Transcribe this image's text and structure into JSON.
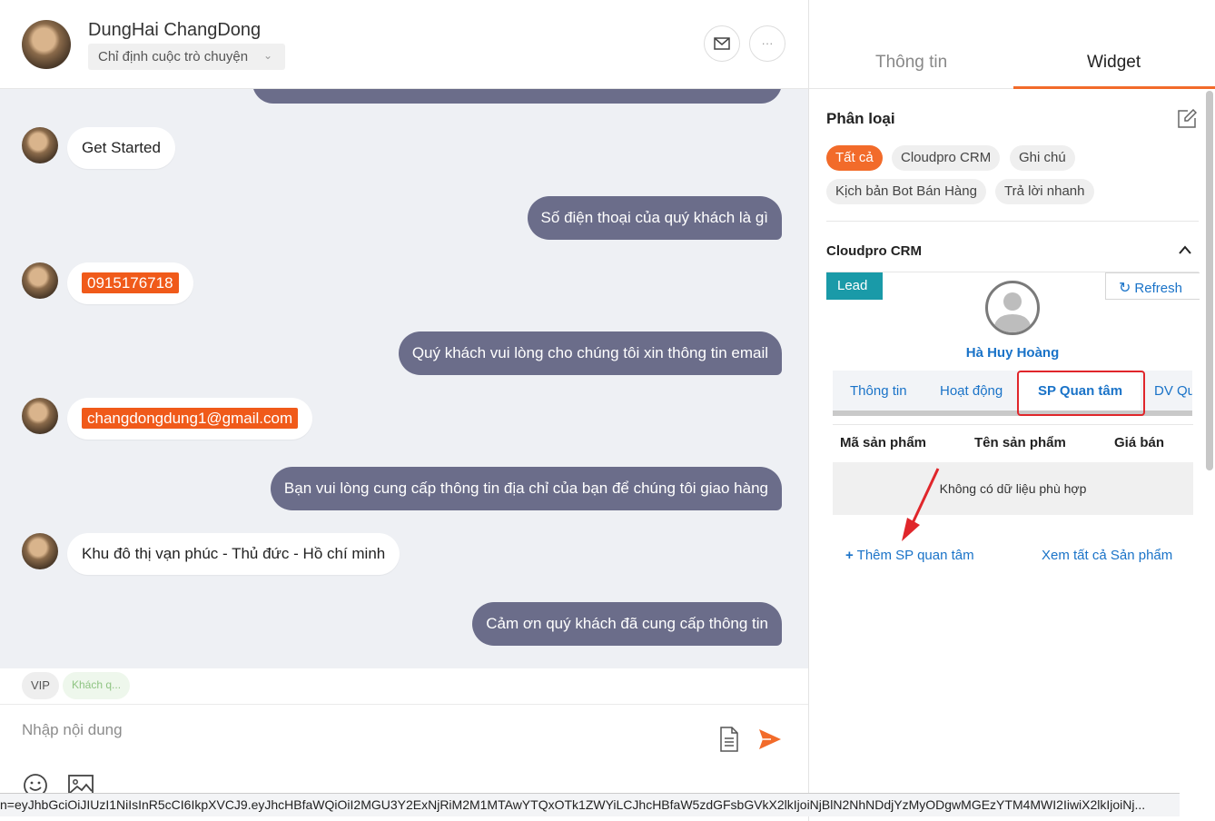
{
  "header": {
    "contact_name": "DungHai ChangDong",
    "assign_label": "Chỉ định cuộc trò chuyện",
    "more_label": "···"
  },
  "messages": [
    {
      "dir": "in",
      "text": "Get Started"
    },
    {
      "dir": "out",
      "text": "Số điện thoại của quý khách là gì"
    },
    {
      "dir": "in",
      "text": "0915176718",
      "highlight": true
    },
    {
      "dir": "out",
      "text": "Quý khách vui lòng cho chúng tôi xin thông tin email"
    },
    {
      "dir": "in",
      "text": "changdongdung1@gmail.com",
      "highlight": true
    },
    {
      "dir": "out",
      "text": "Bạn vui lòng cung cấp thông tin địa chỉ của bạn để chúng tôi giao hàng"
    },
    {
      "dir": "in",
      "text": "Khu đô thị vạn phúc - Thủ đức - Hồ chí minh"
    },
    {
      "dir": "out",
      "text": "Cảm ơn quý khách đã cung cấp thông tin"
    }
  ],
  "tags": [
    "VIP",
    "Khách q..."
  ],
  "composer": {
    "placeholder": "Nhập nội dung"
  },
  "side_tabs": [
    "Thông tin",
    "Widget"
  ],
  "classification": {
    "title": "Phân loại",
    "chips": [
      "Tất cả",
      "Cloudpro CRM",
      "Ghi chú",
      "Kịch bản Bot Bán Hàng",
      "Trả lời nhanh"
    ]
  },
  "crm": {
    "title": "Cloudpro CRM",
    "badge": "Lead",
    "refresh_label": "Refresh",
    "contact_name": "Hà Huy Hoàng",
    "tabs": [
      "Thông tin",
      "Hoạt động",
      "SP Quan tâm",
      "DV Qu"
    ],
    "active_tab": "SP Quan tâm",
    "columns": [
      "Mã sản phẩm",
      "Tên sản phẩm",
      "Giá bán"
    ],
    "empty_text": "Không có dữ liệu phù hợp",
    "add_link": "Thêm SP quan tâm",
    "view_all_link": "Xem tất cả Sản phẩm"
  },
  "status_bar": {
    "url": "n=eyJhbGciOiJIUzI1NiIsInR5cCI6IkpXVCJ9.eyJhcHBfaWQiOiI2MGU3Y2ExNjRiM2M1MTAwYTQxOTk1ZWYiLCJhcHBfaW5zdGFsbGVkX2lkIjoiNjBlN2NhNDdjYzMyODgwMGEzYTM4MWI2IiwiX2lkIjoiNj..."
  },
  "colors": {
    "accent": "#f26b2a",
    "outgoing_bubble": "#6b6d8a",
    "link": "#1a73c8",
    "lead_badge": "#1a9aa8",
    "highlight": "#e0262b"
  }
}
